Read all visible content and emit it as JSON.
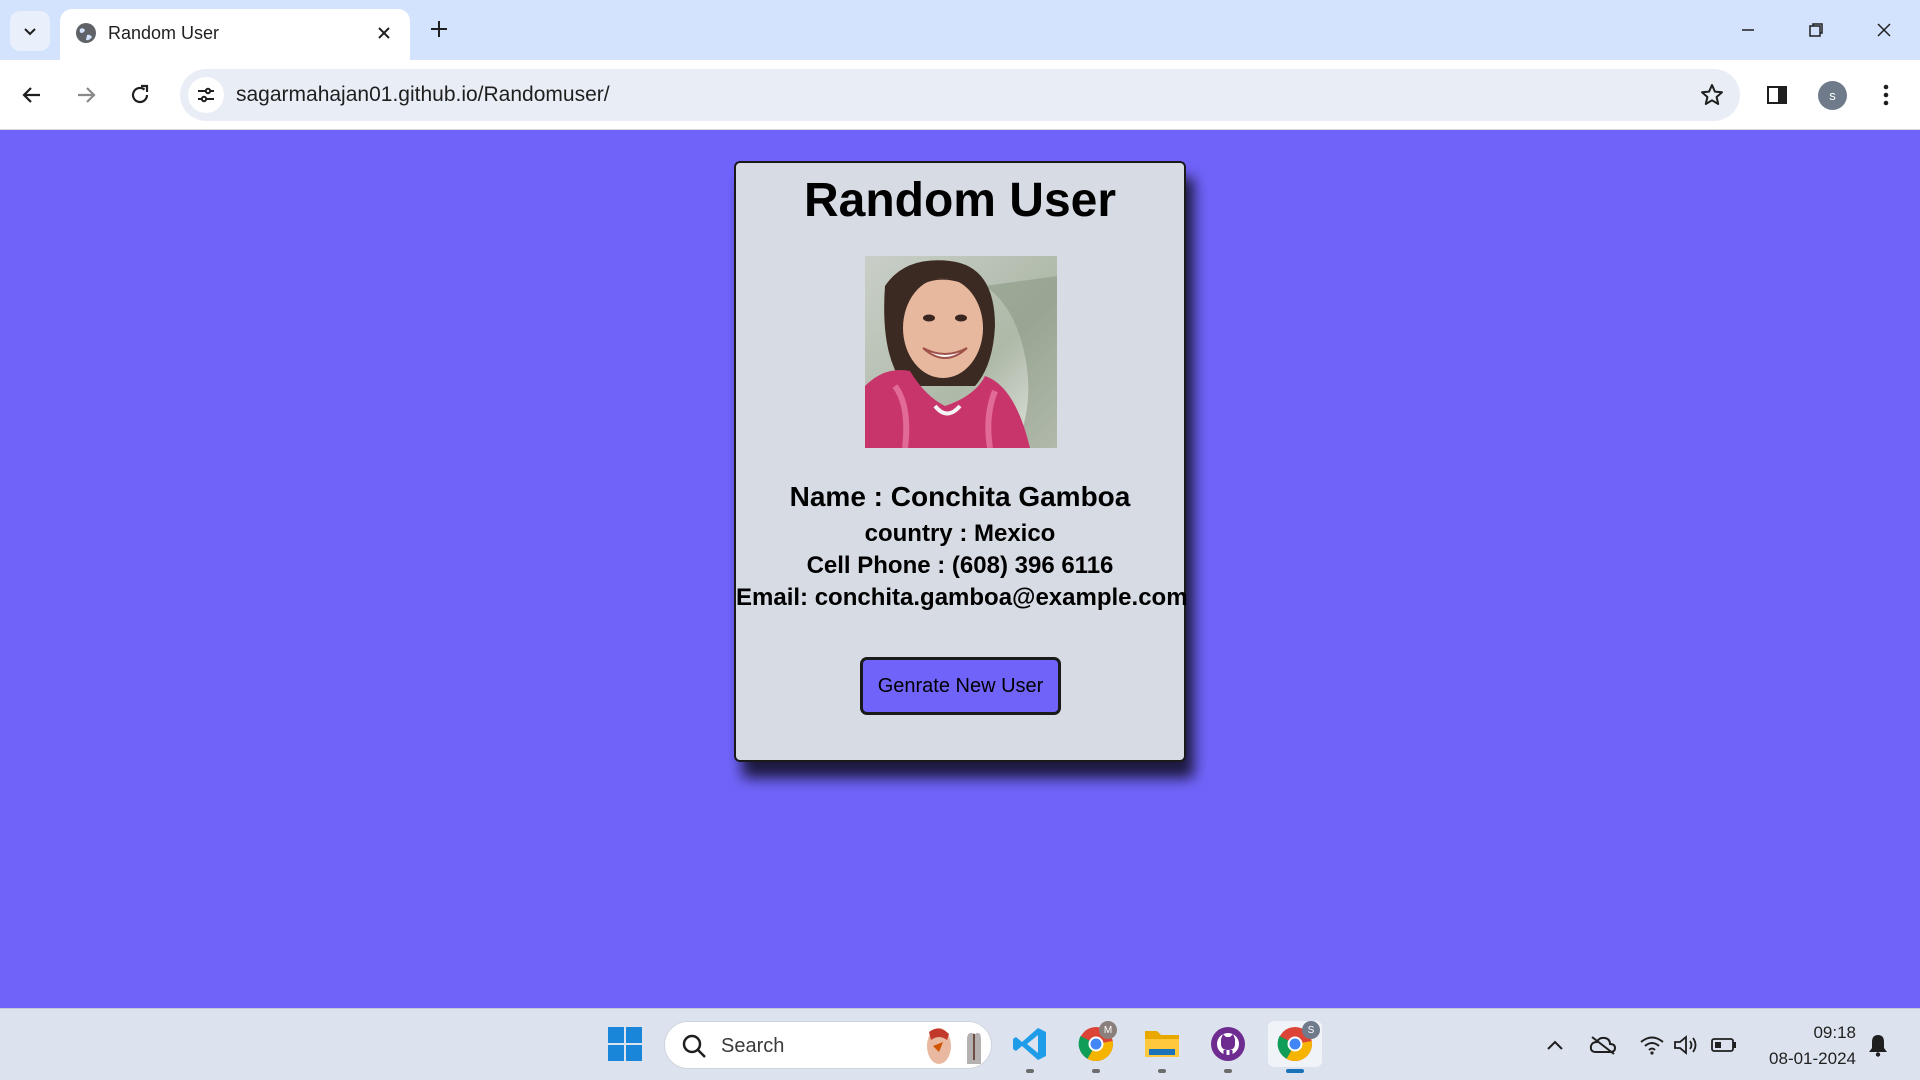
{
  "browser": {
    "tab_title": "Random User",
    "url": "sagarmahajan01.github.io/Randomuser/",
    "profile_initial": "s"
  },
  "card": {
    "title": "Random User",
    "name_line": "Name : Conchita Gamboa",
    "country_line": "country : Mexico",
    "phone_line": "Cell Phone : (608) 396 6116",
    "email_line": "Email: conchita.gamboa@example.com",
    "button_label": "Genrate New User"
  },
  "taskbar": {
    "search_placeholder": "Search",
    "chrome_badge_1": "M",
    "chrome_badge_2": "S",
    "time": "09:18",
    "date": "08-01-2024"
  },
  "colors": {
    "page_background": "#7063fa",
    "card_background": "#d7dce4",
    "button_background": "#7063fa"
  }
}
